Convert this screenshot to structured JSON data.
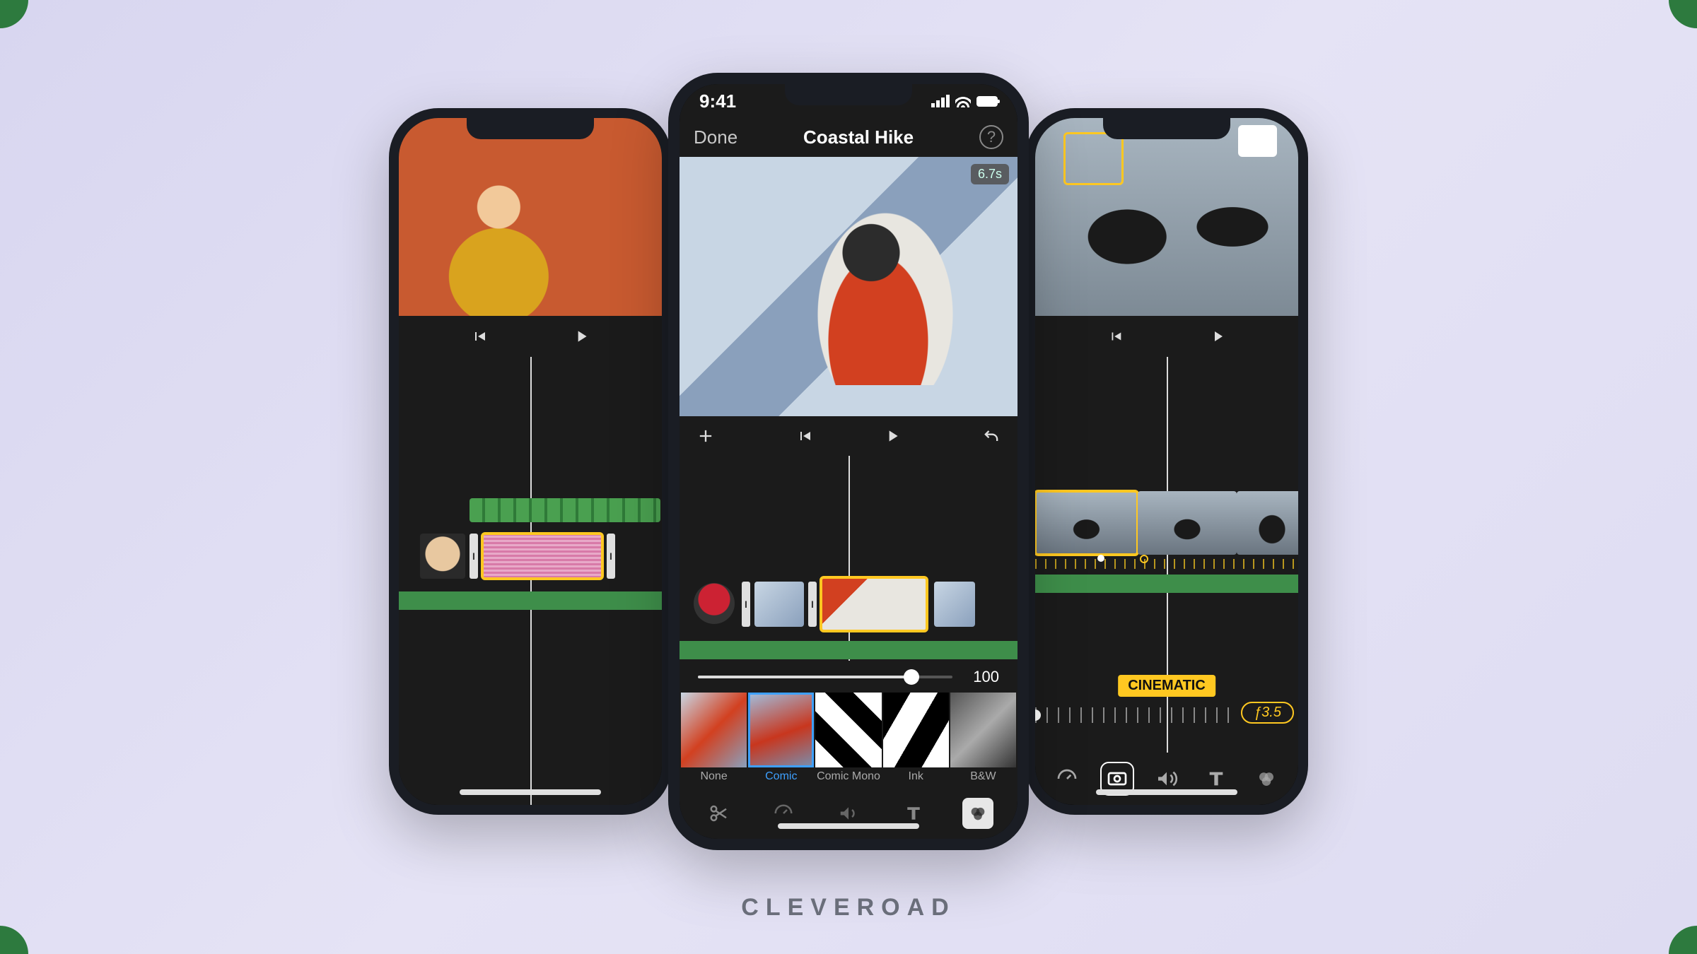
{
  "brand": "CLEVEROAD",
  "center": {
    "status_time": "9:41",
    "done_label": "Done",
    "project_title": "Coastal Hike",
    "help_glyph": "?",
    "duration_badge": "6.7s",
    "slider_value": "100",
    "filters": [
      {
        "label": "None"
      },
      {
        "label": "Comic"
      },
      {
        "label": "Comic Mono"
      },
      {
        "label": "Ink"
      },
      {
        "label": "B&W"
      }
    ]
  },
  "right": {
    "cinematic_label": "CINEMATIC",
    "f_value": "ƒ3.5"
  }
}
